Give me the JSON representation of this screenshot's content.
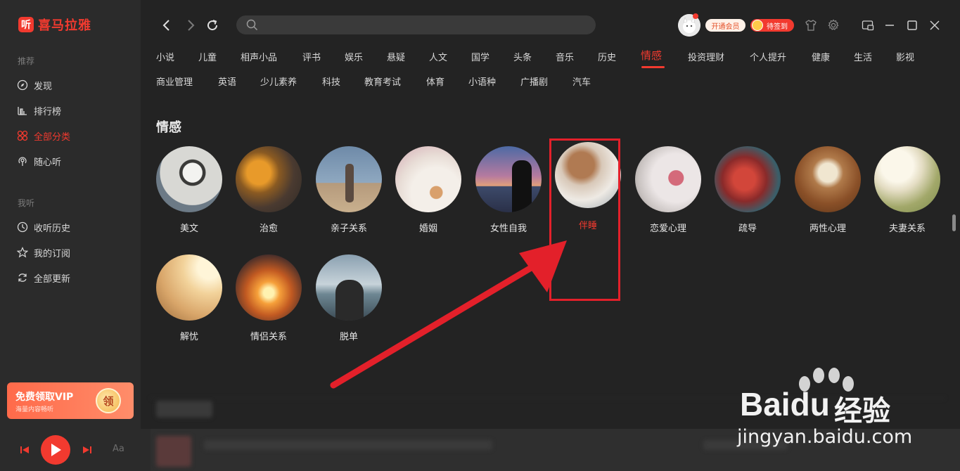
{
  "app": {
    "logo_glyph": "听",
    "name": "喜马拉雅",
    "brand_color": "#f23a2f"
  },
  "sidebar": {
    "section_recommend": "推荐",
    "recommend_items": [
      {
        "label": "发现",
        "icon": "compass-icon"
      },
      {
        "label": "排行榜",
        "icon": "chart-bar-icon"
      },
      {
        "label": "全部分类",
        "icon": "grid-icon",
        "active": true
      },
      {
        "label": "随心听",
        "icon": "radio-icon"
      }
    ],
    "section_mine": "我听",
    "mine_items": [
      {
        "label": "收听历史",
        "icon": "clock-icon"
      },
      {
        "label": "我的订阅",
        "icon": "star-icon"
      },
      {
        "label": "全部更新",
        "icon": "refresh-icon"
      }
    ],
    "vip_banner": {
      "title": "免费领取VIP",
      "subtitle": "海量内容畅听",
      "coin": "领"
    }
  },
  "topbar": {
    "search_placeholder": "",
    "vip_pill": "开通会员",
    "sign_pill": "待签到"
  },
  "categories": {
    "row1": [
      "小说",
      "儿童",
      "相声小品",
      "评书",
      "娱乐",
      "悬疑",
      "人文",
      "国学",
      "头条",
      "音乐",
      "历史",
      "情感",
      "投资理财",
      "个人提升",
      "健康",
      "生活",
      "影视"
    ],
    "row2": [
      "商业管理",
      "英语",
      "少儿素养",
      "科技",
      "教育考试",
      "体育",
      "小语种",
      "广播剧",
      "汽车"
    ],
    "active": "情感"
  },
  "section": {
    "title": "情感",
    "subcategories": [
      "美文",
      "治愈",
      "亲子关系",
      "婚姻",
      "女性自我",
      "伴睡",
      "恋爱心理",
      "疏导",
      "两性心理",
      "夫妻关系",
      "解忧",
      "情侣关系",
      "脱单"
    ],
    "highlighted": "伴睡"
  },
  "player": {
    "font_btn": "Aa"
  },
  "watermark": {
    "brand": "Bai",
    "brand2": "du",
    "cn": "经验",
    "url": "jingyan.baidu.com"
  }
}
